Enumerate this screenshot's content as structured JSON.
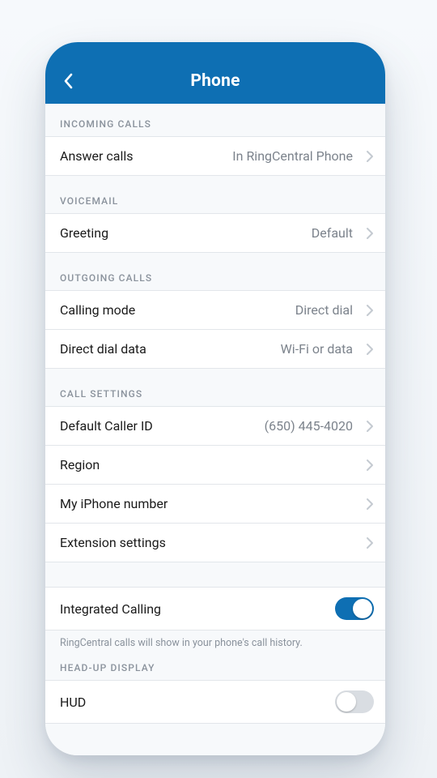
{
  "header": {
    "title": "Phone"
  },
  "sections": {
    "incoming": {
      "header": "INCOMING CALLS",
      "answer_calls_label": "Answer calls",
      "answer_calls_value": "In RingCentral Phone"
    },
    "voicemail": {
      "header": "VOICEMAIL",
      "greeting_label": "Greeting",
      "greeting_value": "Default"
    },
    "outgoing": {
      "header": "OUTGOING CALLS",
      "calling_mode_label": "Calling mode",
      "calling_mode_value": "Direct dial",
      "direct_dial_data_label": "Direct dial data",
      "direct_dial_data_value": "Wi-Fi or data"
    },
    "call_settings": {
      "header": "CALL SETTINGS",
      "default_caller_id_label": "Default Caller ID",
      "default_caller_id_value": "(650) 445-4020",
      "region_label": "Region",
      "my_iphone_number_label": "My iPhone number",
      "extension_settings_label": "Extension settings"
    },
    "integrated": {
      "integrated_calling_label": "Integrated Calling",
      "integrated_calling_on": true,
      "note": "RingCentral calls will show in your phone's call history."
    },
    "hud": {
      "header": "HEAD-UP DISPLAY",
      "hud_label": "HUD",
      "hud_on": false
    }
  }
}
